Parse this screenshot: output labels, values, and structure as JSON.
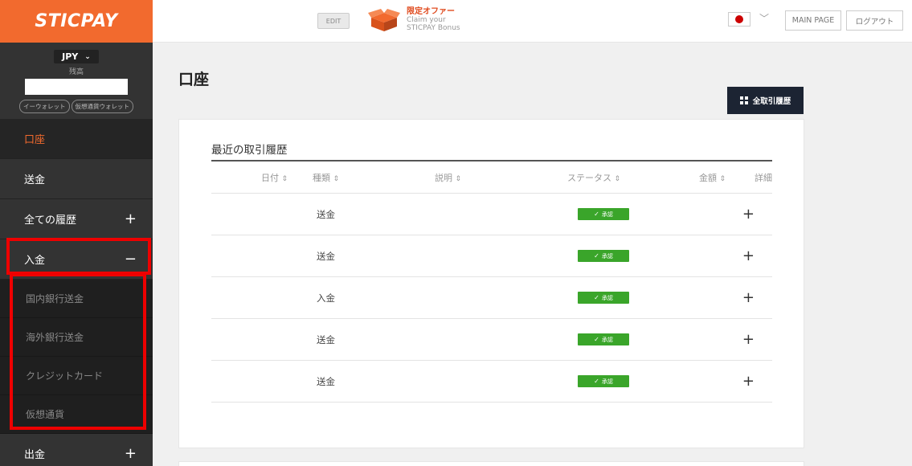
{
  "sidebar": {
    "logo": "STICPAY",
    "currency": "JPY",
    "balance_label": "残高",
    "wallet_buttons": [
      "イーウォレット",
      "仮想通貨ウォレット"
    ],
    "menu": {
      "account": "口座",
      "send": "送金",
      "all_history": "全ての履歴",
      "deposit": "入金",
      "withdraw": "出金"
    },
    "deposit_sub": [
      "国内銀行送金",
      "海外銀行送金",
      "クレジットカード",
      "仮想通貨"
    ],
    "toggles": {
      "plus": "+",
      "minus": "−"
    }
  },
  "topbar": {
    "edit": "EDIT",
    "offer_title": "限定オファー",
    "offer_line1": "Claim your",
    "offer_line2": "STICPAY Bonus",
    "main_page": "MAIN PAGE",
    "logout": "ログアウト"
  },
  "main": {
    "title": "口座",
    "all_history_btn": "全取引履歴",
    "card_title": "最近の取引履歴",
    "columns": {
      "date": "日付",
      "type": "種類",
      "description": "説明",
      "status": "ステータス",
      "amount": "金額",
      "detail": "詳細"
    },
    "sort_glyph": "⇕",
    "rows": [
      {
        "type": "送金",
        "status": "承認",
        "expand": "+"
      },
      {
        "type": "送金",
        "status": "承認",
        "expand": "+"
      },
      {
        "type": "入金",
        "status": "承認",
        "expand": "+"
      },
      {
        "type": "送金",
        "status": "承認",
        "expand": "+"
      },
      {
        "type": "送金",
        "status": "承認",
        "expand": "+"
      }
    ]
  },
  "colors": {
    "brand_orange": "#f26a2e",
    "sidebar_bg": "#333333",
    "approved_green": "#3aa52a",
    "highlight_red": "#ee0000",
    "dark_button": "#1c2433"
  }
}
